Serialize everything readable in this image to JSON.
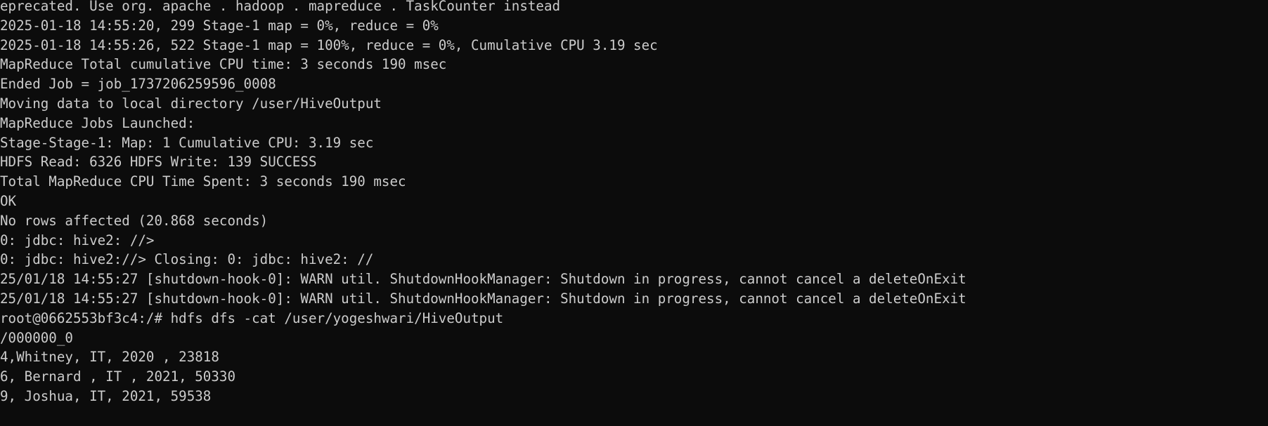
{
  "terminal": {
    "lines": [
      "eprecated. Use org. apache . hadoop . mapreduce . TaskCounter instead",
      "2025-01-18 14:55:20, 299 Stage-1 map = 0%, reduce = 0%",
      "2025-01-18 14:55:26, 522 Stage-1 map = 100%, reduce = 0%, Cumulative CPU 3.19 sec",
      "MapReduce Total cumulative CPU time: 3 seconds 190 msec",
      "Ended Job = job_1737206259596_0008",
      "Moving data to local directory /user/HiveOutput",
      "MapReduce Jobs Launched:",
      "Stage-Stage-1: Map: 1 Cumulative CPU: 3.19 sec",
      "HDFS Read: 6326 HDFS Write: 139 SUCCESS",
      "Total MapReduce CPU Time Spent: 3 seconds 190 msec",
      "OK",
      "No rows affected (20.868 seconds)",
      "0: jdbc: hive2: //>",
      "0: jdbc: hive2://> Closing: 0: jdbc: hive2: //",
      "25/01/18 14:55:27 [shutdown-hook-0]: WARN util. ShutdownHookManager: Shutdown in progress, cannot cancel a deleteOnExit",
      "25/01/18 14:55:27 [shutdown-hook-0]: WARN util. ShutdownHookManager: Shutdown in progress, cannot cancel a deleteOnExit",
      "root@0662553bf3c4:/# hdfs dfs -cat /user/yogeshwari/HiveOutput",
      "/000000_0",
      "4,Whitney, IT, 2020 , 23818",
      "6, Bernard , IT , 2021, 50330",
      "9, Joshua, IT, 2021, 59538"
    ]
  },
  "colors": {
    "background": "#0c0c0c",
    "foreground": "#cccccc"
  }
}
